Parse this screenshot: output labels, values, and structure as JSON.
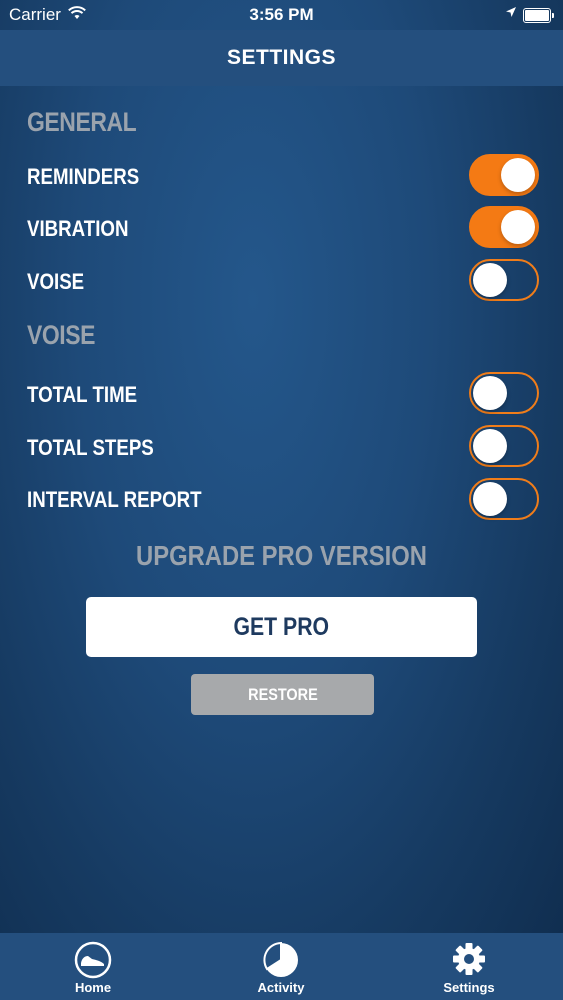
{
  "status_bar": {
    "carrier": "Carrier",
    "time": "3:56 PM"
  },
  "nav": {
    "title": "SETTINGS"
  },
  "general": {
    "header": "GENERAL",
    "items": [
      {
        "label": "REMINDERS",
        "on": true
      },
      {
        "label": "VIBRATION",
        "on": true
      },
      {
        "label": "VOISE",
        "on": false
      }
    ]
  },
  "voise": {
    "header": "VOISE",
    "items": [
      {
        "label": "TOTAL TIME",
        "on": false
      },
      {
        "label": "TOTAL STEPS",
        "on": false
      },
      {
        "label": "INTERVAL REPORT",
        "on": false
      }
    ]
  },
  "upgrade": {
    "title": "UPGRADE PRO VERSION",
    "get_pro_label": "GET PRO",
    "restore_label": "RESTORE"
  },
  "tabs": [
    {
      "label": "Home",
      "icon": "shoe-icon"
    },
    {
      "label": "Activity",
      "icon": "pie-chart-icon"
    },
    {
      "label": "Settings",
      "icon": "gear-icon"
    }
  ],
  "colors": {
    "accent": "#f47a14",
    "nav_bg": "#244f7e"
  }
}
